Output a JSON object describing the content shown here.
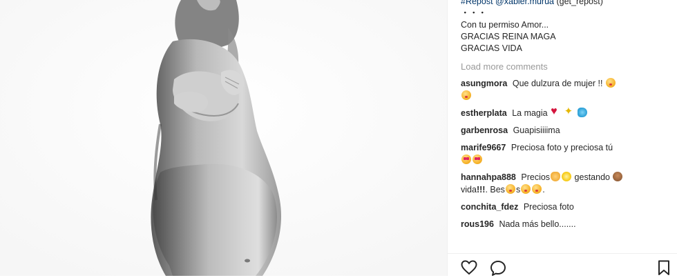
{
  "caption": {
    "hashtag": "#Repost",
    "mention": "@xabier.murua",
    "source": "(get_repost)",
    "dots": "・・・",
    "lines": [
      "Con tu permiso Amor...",
      "GRACIAS REINA MAGA",
      "GRACIAS VIDA"
    ]
  },
  "load_more": "Load more comments",
  "comments": [
    {
      "user": "asungmora",
      "text": "Que dulzura de mujer !!"
    },
    {
      "user": "estherplata",
      "text": "La magia"
    },
    {
      "user": "garbenrosa",
      "text": "Guapisiiiima"
    },
    {
      "user": "marife9667",
      "text": "Preciosa foto y preciosa tú"
    },
    {
      "user": "hannahpa888",
      "text_a": "Precios",
      "text_b": "gestando",
      "text_c": "vida",
      "text_d": "!!!",
      "text_e": ". Bes",
      "text_f": "s",
      "text_g": "."
    },
    {
      "user": "conchita_fdez",
      "text": "Preciosa foto"
    },
    {
      "user": "rous196",
      "text": "Nada más bello......."
    }
  ],
  "icons": {
    "like": "heart-outline-icon",
    "comment": "speech-bubble-icon",
    "save": "bookmark-icon"
  }
}
